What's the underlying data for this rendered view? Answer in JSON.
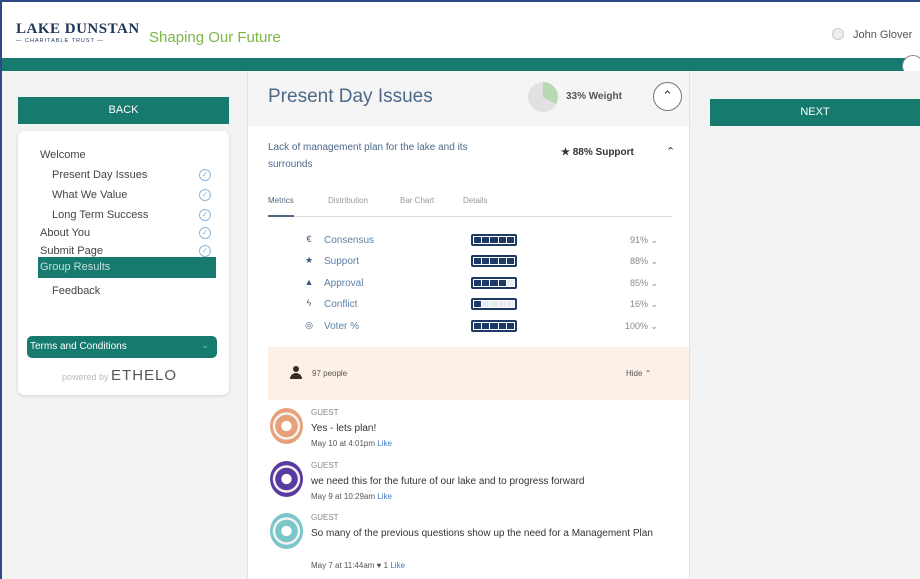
{
  "header": {
    "logo_main": "LAKE DUNSTAN",
    "logo_sub": "— CHARITABLE TRUST —",
    "tagline": "Shaping Our Future",
    "user_name": "John Glover",
    "user_icon": "user-circle-icon"
  },
  "colors": {
    "teal": "#177a6f",
    "navy": "#1d3a66",
    "tagline_green": "#7ab843",
    "title_blue": "#4c6987",
    "link_blue": "#4078c0",
    "peach": "#fdf0e6"
  },
  "sidebar": {
    "back_label": "BACK",
    "items": [
      {
        "label": "Welcome",
        "completed": false
      },
      {
        "label": "Present Day Issues",
        "completed": true
      },
      {
        "label": "What We Value",
        "completed": true
      },
      {
        "label": "Long Term Success",
        "completed": true
      },
      {
        "label": "About You",
        "completed": true
      },
      {
        "label": "Submit Page",
        "completed": true
      },
      {
        "label": "Group Results",
        "active": true
      },
      {
        "label": "Feedback",
        "completed": false
      }
    ],
    "check_glyph": "✓",
    "terms_label": "Terms and Conditions",
    "terms_chevron": "⌄",
    "powered_prefix": "powered by",
    "powered_brand": "ETHELO"
  },
  "main": {
    "title": "Present Day Issues",
    "weight_label": "33% Weight",
    "weight_fraction": 0.33,
    "collapse_glyph": "⌃",
    "issue_text": "Lack of management plan for the lake and its surrounds",
    "support_label": "★ 88% Support",
    "support_chevron": "⌃",
    "tabs": [
      {
        "label": "Metrics",
        "active": true
      },
      {
        "label": "Distribution"
      },
      {
        "label": "Bar Chart"
      },
      {
        "label": "Details"
      }
    ],
    "metrics": [
      {
        "icon": "€",
        "icon_name": "euro-icon",
        "label": "Consensus",
        "value": "91% ⌄",
        "filled_segments": 5
      },
      {
        "icon": "★",
        "icon_name": "star-icon",
        "label": "Support",
        "value": "88% ⌄",
        "filled_segments": 5
      },
      {
        "icon": "▲",
        "icon_name": "thumbs-up-icon",
        "label": "Approval",
        "value": "85% ⌄",
        "filled_segments": 4
      },
      {
        "icon": "ϟ",
        "icon_name": "lightning-icon",
        "label": "Conflict",
        "value": "16% ⌄",
        "filled_segments": 1
      },
      {
        "icon": "◎",
        "icon_name": "voter-icon",
        "label": "Voter %",
        "value": "100% ⌄",
        "filled_segments": 5
      }
    ],
    "people": {
      "count_label": "97 people",
      "hide_label": "Hide  ⌃"
    },
    "comments": [
      {
        "author": "GUEST",
        "text": "Yes - lets plan!",
        "time": "May 10 at 4:01pm",
        "like": "Like",
        "avatar_color": "#e8a07a"
      },
      {
        "author": "GUEST",
        "text": "we need this for the future of our lake and to progress forward",
        "time": "May 9 at 10:29am",
        "like": "Like",
        "avatar_color": "#5a3aa0"
      },
      {
        "author": "GUEST",
        "text": "So many of the previous questions show up the need for a Management Plan",
        "time": "May 7 at 11:44am ♥ 1",
        "like": "Like",
        "avatar_color": "#7ac6c9"
      }
    ]
  },
  "right": {
    "next_label": "NEXT"
  }
}
